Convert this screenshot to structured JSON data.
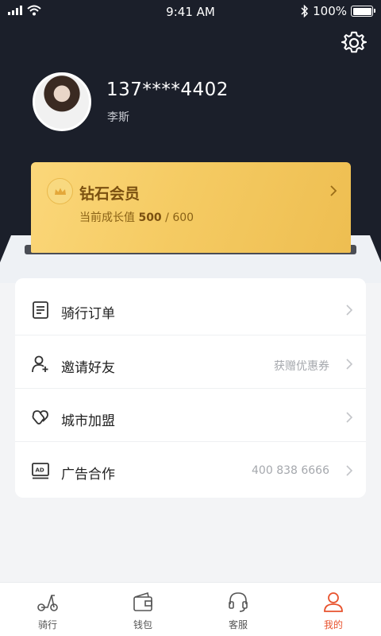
{
  "status_bar": {
    "time": "9:41 AM",
    "battery_text": "100%"
  },
  "profile": {
    "phone": "137****4402",
    "name": "李斯"
  },
  "vip": {
    "title": "钻石会员",
    "progress_label": "当前成长值",
    "progress_current": "500",
    "progress_separator": " / ",
    "progress_max": "600"
  },
  "menu": {
    "items": [
      {
        "label": "骑行订单",
        "value": "",
        "icon": "document-icon"
      },
      {
        "label": "邀请好友",
        "value": "获赠优惠券",
        "icon": "add-user-icon"
      },
      {
        "label": "城市加盟",
        "value": "",
        "icon": "handshake-icon"
      },
      {
        "label": "广告合作",
        "value": "400 838 6666",
        "icon": "ad-screen-icon"
      }
    ]
  },
  "nav": {
    "items": [
      {
        "label": "骑行",
        "icon": "scooter-icon"
      },
      {
        "label": "钱包",
        "icon": "wallet-icon"
      },
      {
        "label": "客服",
        "icon": "headset-icon"
      },
      {
        "label": "我的",
        "icon": "person-icon"
      }
    ],
    "active_index": 3
  },
  "colors": {
    "header_bg": "#1b1f2a",
    "accent": "#e8532e",
    "gold": "#f5cb63"
  }
}
